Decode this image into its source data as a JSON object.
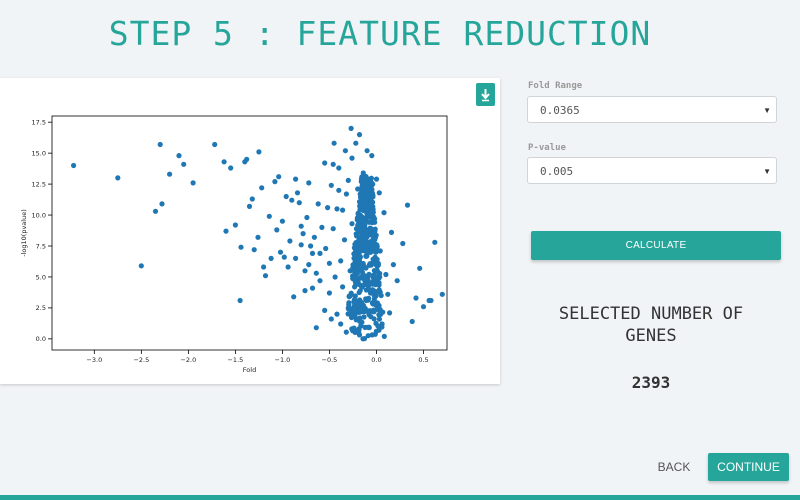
{
  "page": {
    "title": "STEP 5 : FEATURE REDUCTION",
    "accent_color": "#26a69a"
  },
  "download": {
    "icon": "download-icon"
  },
  "fold_range": {
    "label": "Fold Range",
    "value": "0.0365"
  },
  "p_value": {
    "label": "P-value",
    "value": "0.005"
  },
  "calculate_label": "CALCULATE",
  "selection": {
    "title": "SELECTED NUMBER OF GENES",
    "count": "2393"
  },
  "nav": {
    "back_label": "BACK",
    "continue_label": "CONTINUE"
  },
  "chart_data": {
    "type": "scatter",
    "title": "",
    "xlabel": "Fold",
    "ylabel": "-log10(pvalue)",
    "xlim": [
      -3.45,
      0.75
    ],
    "ylim": [
      -0.9,
      18.0
    ],
    "xticks": [
      -3.0,
      -2.5,
      -2.0,
      -1.5,
      -1.0,
      -0.5,
      0.0,
      0.5
    ],
    "yticks": [
      0.0,
      2.5,
      5.0,
      7.5,
      10.0,
      12.5,
      15.0,
      17.5
    ],
    "xtick_labels": [
      "−3.0",
      "−2.5",
      "−2.0",
      "−1.5",
      "−1.0",
      "−0.5",
      "0.0",
      "0.5"
    ],
    "ytick_labels": [
      "0.0",
      "2.5",
      "5.0",
      "7.5",
      "10.0",
      "12.5",
      "15.0",
      "17.5"
    ],
    "point_color": "#1f77b4",
    "grid": false,
    "points": [
      [
        -3.22,
        14.0
      ],
      [
        -2.75,
        13.0
      ],
      [
        -2.5,
        5.9
      ],
      [
        -2.35,
        10.3
      ],
      [
        -2.3,
        15.7
      ],
      [
        -2.28,
        10.9
      ],
      [
        -2.2,
        13.3
      ],
      [
        -2.1,
        14.8
      ],
      [
        -2.05,
        14.1
      ],
      [
        -1.95,
        12.6
      ],
      [
        -1.72,
        15.7
      ],
      [
        -1.62,
        14.3
      ],
      [
        -1.6,
        8.7
      ],
      [
        -1.55,
        13.8
      ],
      [
        -1.5,
        9.2
      ],
      [
        -1.45,
        3.1
      ],
      [
        -1.4,
        14.3
      ],
      [
        -1.38,
        14.5
      ],
      [
        -1.35,
        10.7
      ],
      [
        -1.3,
        7.2
      ],
      [
        -1.25,
        15.1
      ],
      [
        -1.22,
        12.2
      ],
      [
        -1.18,
        5.1
      ],
      [
        -1.12,
        6.5
      ],
      [
        -1.08,
        12.7
      ],
      [
        -1.04,
        13.1
      ],
      [
        -1.0,
        9.5
      ],
      [
        -0.96,
        11.5
      ],
      [
        -0.92,
        7.9
      ],
      [
        -0.88,
        3.4
      ],
      [
        -0.84,
        11.8
      ],
      [
        -0.8,
        9.1
      ],
      [
        -0.76,
        5.5
      ],
      [
        -0.72,
        12.6
      ],
      [
        -0.68,
        6.9
      ],
      [
        -0.64,
        0.9
      ],
      [
        -0.6,
        4.7
      ],
      [
        -0.55,
        14.2
      ],
      [
        -0.5,
        3.7
      ],
      [
        -0.45,
        15.8
      ],
      [
        -0.42,
        10.5
      ],
      [
        -0.38,
        6.3
      ],
      [
        -0.33,
        15.2
      ],
      [
        -0.3,
        2.5
      ],
      [
        -0.27,
        17.0
      ],
      [
        -0.22,
        15.8
      ],
      [
        -0.18,
        16.5
      ],
      [
        -0.12,
        11.2
      ],
      [
        -0.08,
        8.4
      ],
      [
        -0.05,
        14.8
      ],
      [
        0.02,
        6.1
      ],
      [
        0.08,
        10.2
      ],
      [
        0.12,
        3.6
      ],
      [
        0.18,
        6.0
      ],
      [
        0.22,
        4.7
      ],
      [
        0.28,
        7.7
      ],
      [
        0.33,
        10.8
      ],
      [
        0.38,
        1.4
      ],
      [
        0.42,
        3.3
      ],
      [
        0.46,
        5.7
      ],
      [
        0.5,
        2.6
      ],
      [
        0.56,
        3.1
      ],
      [
        0.58,
        3.1
      ],
      [
        0.62,
        7.8
      ],
      [
        0.7,
        3.6
      ],
      [
        -0.9,
        11.2
      ],
      [
        -0.86,
        12.9
      ],
      [
        -0.82,
        11.0
      ],
      [
        -0.78,
        8.5
      ],
      [
        -0.74,
        9.8
      ],
      [
        -0.7,
        7.5
      ],
      [
        -0.66,
        8.2
      ],
      [
        -0.62,
        10.9
      ],
      [
        -0.58,
        9.0
      ],
      [
        -0.54,
        7.3
      ],
      [
        -0.5,
        6.1
      ],
      [
        -0.46,
        8.9
      ],
      [
        -0.44,
        5.0
      ],
      [
        -0.4,
        12.0
      ],
      [
        -0.36,
        4.2
      ],
      [
        -0.34,
        8.0
      ],
      [
        -0.32,
        11.7
      ],
      [
        -0.28,
        5.5
      ],
      [
        -0.26,
        9.3
      ],
      [
        -0.24,
        3.0
      ],
      [
        -0.2,
        6.8
      ],
      [
        -0.16,
        2.2
      ],
      [
        -0.14,
        13.4
      ],
      [
        -0.1,
        4.9
      ],
      [
        -0.06,
        1.8
      ],
      [
        -0.02,
        9.7
      ],
      [
        0.01,
        2.9
      ],
      [
        0.04,
        7.1
      ],
      [
        0.06,
        1.2
      ],
      [
        0.1,
        5.2
      ],
      [
        0.14,
        2.1
      ],
      [
        0.16,
        8.6
      ],
      [
        -0.55,
        2.3
      ],
      [
        -0.48,
        1.6
      ],
      [
        -0.42,
        2.0
      ],
      [
        -0.38,
        1.2
      ],
      [
        -0.6,
        6.9
      ],
      [
        -0.64,
        5.3
      ],
      [
        -0.68,
        4.1
      ],
      [
        -0.72,
        6.0
      ],
      [
        -0.76,
        3.9
      ],
      [
        -0.8,
        7.6
      ],
      [
        -1.02,
        7.0
      ],
      [
        -1.06,
        8.8
      ],
      [
        -1.14,
        9.9
      ],
      [
        -1.2,
        5.8
      ],
      [
        -1.26,
        8.2
      ],
      [
        -1.32,
        11.3
      ],
      [
        -1.44,
        7.4
      ],
      [
        -0.94,
        5.8
      ],
      [
        -0.98,
        6.6
      ],
      [
        -0.86,
        6.5
      ],
      [
        -0.52,
        10.6
      ],
      [
        -0.48,
        12.4
      ],
      [
        -0.46,
        14.1
      ],
      [
        -0.4,
        13.8
      ],
      [
        -0.36,
        10.4
      ],
      [
        -0.3,
        12.8
      ],
      [
        -0.26,
        14.6
      ],
      [
        -0.2,
        12.1
      ],
      [
        0.0,
        12.9
      ],
      [
        -0.04,
        12.5
      ],
      [
        0.03,
        11.8
      ],
      [
        -0.1,
        15.2
      ]
    ]
  }
}
